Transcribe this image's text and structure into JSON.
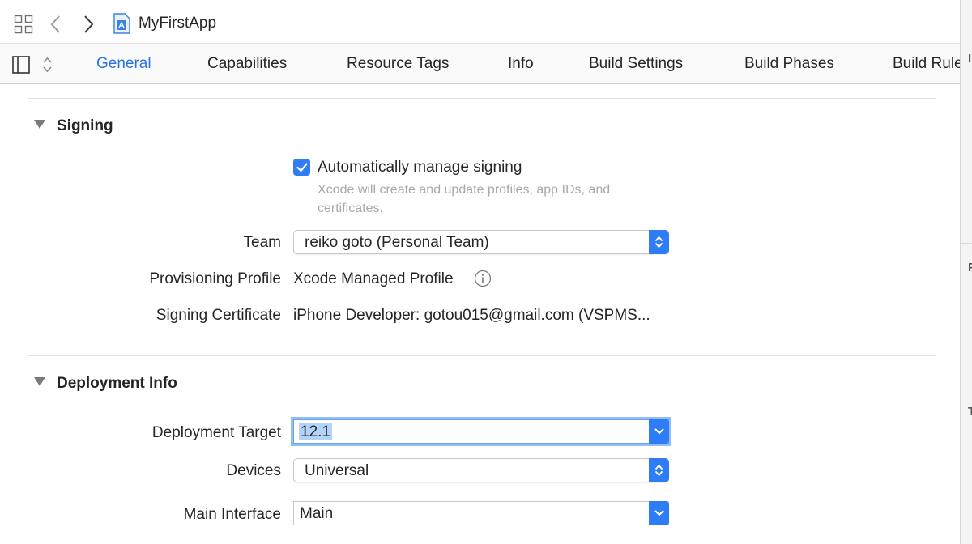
{
  "pathbar": {
    "project_name": "MyFirstApp"
  },
  "tabs": [
    {
      "label": "General",
      "active": true
    },
    {
      "label": "Capabilities"
    },
    {
      "label": "Resource Tags"
    },
    {
      "label": "Info"
    },
    {
      "label": "Build Settings"
    },
    {
      "label": "Build Phases"
    },
    {
      "label": "Build Rule"
    }
  ],
  "signing": {
    "title": "Signing",
    "auto_manage_label": "Automatically manage signing",
    "auto_manage_checked": true,
    "auto_manage_hint": "Xcode will create and update profiles, app IDs, and certificates.",
    "team_label": "Team",
    "team_value": "reiko goto (Personal Team)",
    "profile_label": "Provisioning Profile",
    "profile_value": "Xcode Managed Profile",
    "certificate_label": "Signing Certificate",
    "certificate_value": "iPhone Developer: gotou015@gmail.com (VSPMS..."
  },
  "deployment": {
    "title": "Deployment Info",
    "target_label": "Deployment Target",
    "target_value": "12.1",
    "devices_label": "Devices",
    "devices_value": "Universal",
    "interface_label": "Main Interface",
    "interface_value": "Main"
  },
  "inspector_fragments": [
    "I",
    "P",
    "T"
  ],
  "colors": {
    "accent": "#2a74de",
    "control_blue": "#2f7df6",
    "hint_gray": "#a9a9a9"
  }
}
